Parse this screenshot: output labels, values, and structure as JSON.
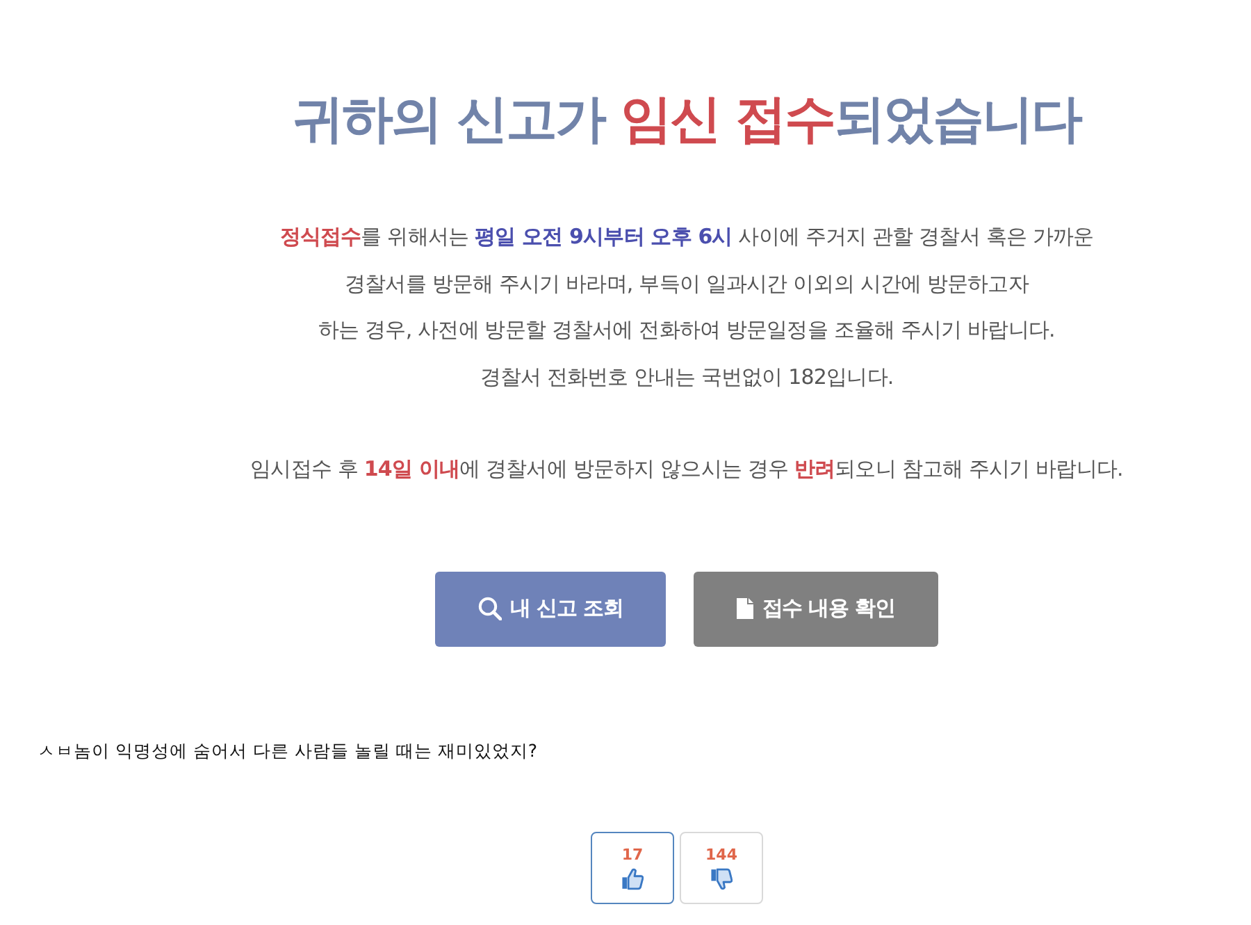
{
  "title": {
    "segments": [
      {
        "text": "귀하의 신고가 ",
        "kind": "plain"
      },
      {
        "text": "임신 접수",
        "kind": "red"
      },
      {
        "text": "되었습니다",
        "kind": "plain"
      }
    ]
  },
  "notice": {
    "paragraphs": [
      {
        "lines": [
          [
            {
              "text": "정식접수",
              "kind": "red"
            },
            {
              "text": "를 위해서는 ",
              "kind": "plain"
            },
            {
              "text": "평일 오전 9시부터 오후 6시",
              "kind": "blue"
            },
            {
              "text": " 사이에 주거지 관할 경찰서 혹은 가까운",
              "kind": "plain"
            }
          ],
          [
            {
              "text": "경찰서를 방문해 주시기 바라며, 부득이 일과시간 이외의 시간에 방문하고자",
              "kind": "plain"
            }
          ],
          [
            {
              "text": "하는 경우, 사전에 방문할 경찰서에 전화하여 방문일정을 조율해 주시기 바랍니다.",
              "kind": "plain"
            }
          ],
          [
            {
              "text": "경찰서 전화번호 안내는 국번없이 182입니다.",
              "kind": "plain"
            }
          ]
        ]
      },
      {
        "lines": [
          [
            {
              "text": "임시접수 후 ",
              "kind": "plain"
            },
            {
              "text": "14일 이내",
              "kind": "red"
            },
            {
              "text": "에 경찰서에 방문하지 않으시는 경우 ",
              "kind": "plain"
            },
            {
              "text": "반려",
              "kind": "red"
            },
            {
              "text": "되오니 참고해 주시기 바랍니다.",
              "kind": "plain"
            }
          ]
        ]
      }
    ]
  },
  "buttons": [
    {
      "label": "내 신고 조회",
      "kind": "primary"
    },
    {
      "label": "접수 내용 확인",
      "kind": "secondary"
    }
  ],
  "comment": {
    "text": "ㅅㅂ놈이 익명성에 숨어서 다른 사람들 놀릴 때는 재미있었지?"
  },
  "votes": [
    {
      "count": "17",
      "kind": "up",
      "selected": true
    },
    {
      "count": "144",
      "kind": "down",
      "selected": false
    }
  ]
}
